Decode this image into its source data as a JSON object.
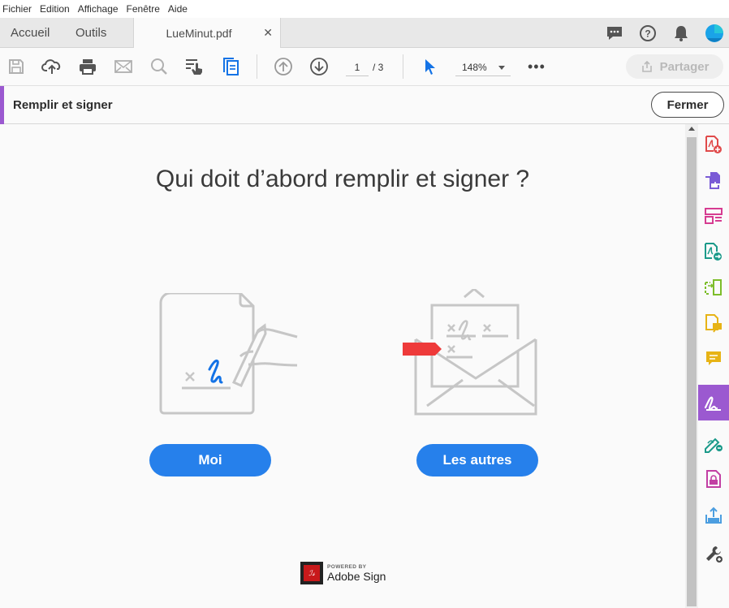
{
  "menu": [
    "Fichier",
    "Edition",
    "Affichage",
    "Fenêtre",
    "Aide"
  ],
  "tabs": {
    "home": "Accueil",
    "tools": "Outils",
    "document": "LueMinut.pdf",
    "close": "✕"
  },
  "toolbar": {
    "page_current": "1",
    "page_total": "/ 3",
    "zoom": "148%",
    "more": "•••",
    "share_label": "Partager"
  },
  "fill_sign_bar": {
    "title": "Remplir et signer",
    "close_label": "Fermer"
  },
  "main": {
    "heading": "Qui doit d’abord remplir et signer ?",
    "button_me": "Moi",
    "button_others": "Les autres",
    "powered_by": "POWERED BY",
    "brand": "Adobe Sign"
  },
  "colors": {
    "accent_purple": "#9b59d0",
    "button_blue": "#2680eb",
    "red_tag": "#ee3a3a"
  },
  "right_panel_icons": [
    "create-pdf-icon",
    "combine-files-icon",
    "organize-pages-icon",
    "export-pdf-icon",
    "edit-pdf-icon",
    "send-for-comments-icon",
    "comment-icon",
    "fill-sign-icon",
    "send-for-signature-icon",
    "protect-icon",
    "share-icon",
    "more-tools-icon"
  ]
}
